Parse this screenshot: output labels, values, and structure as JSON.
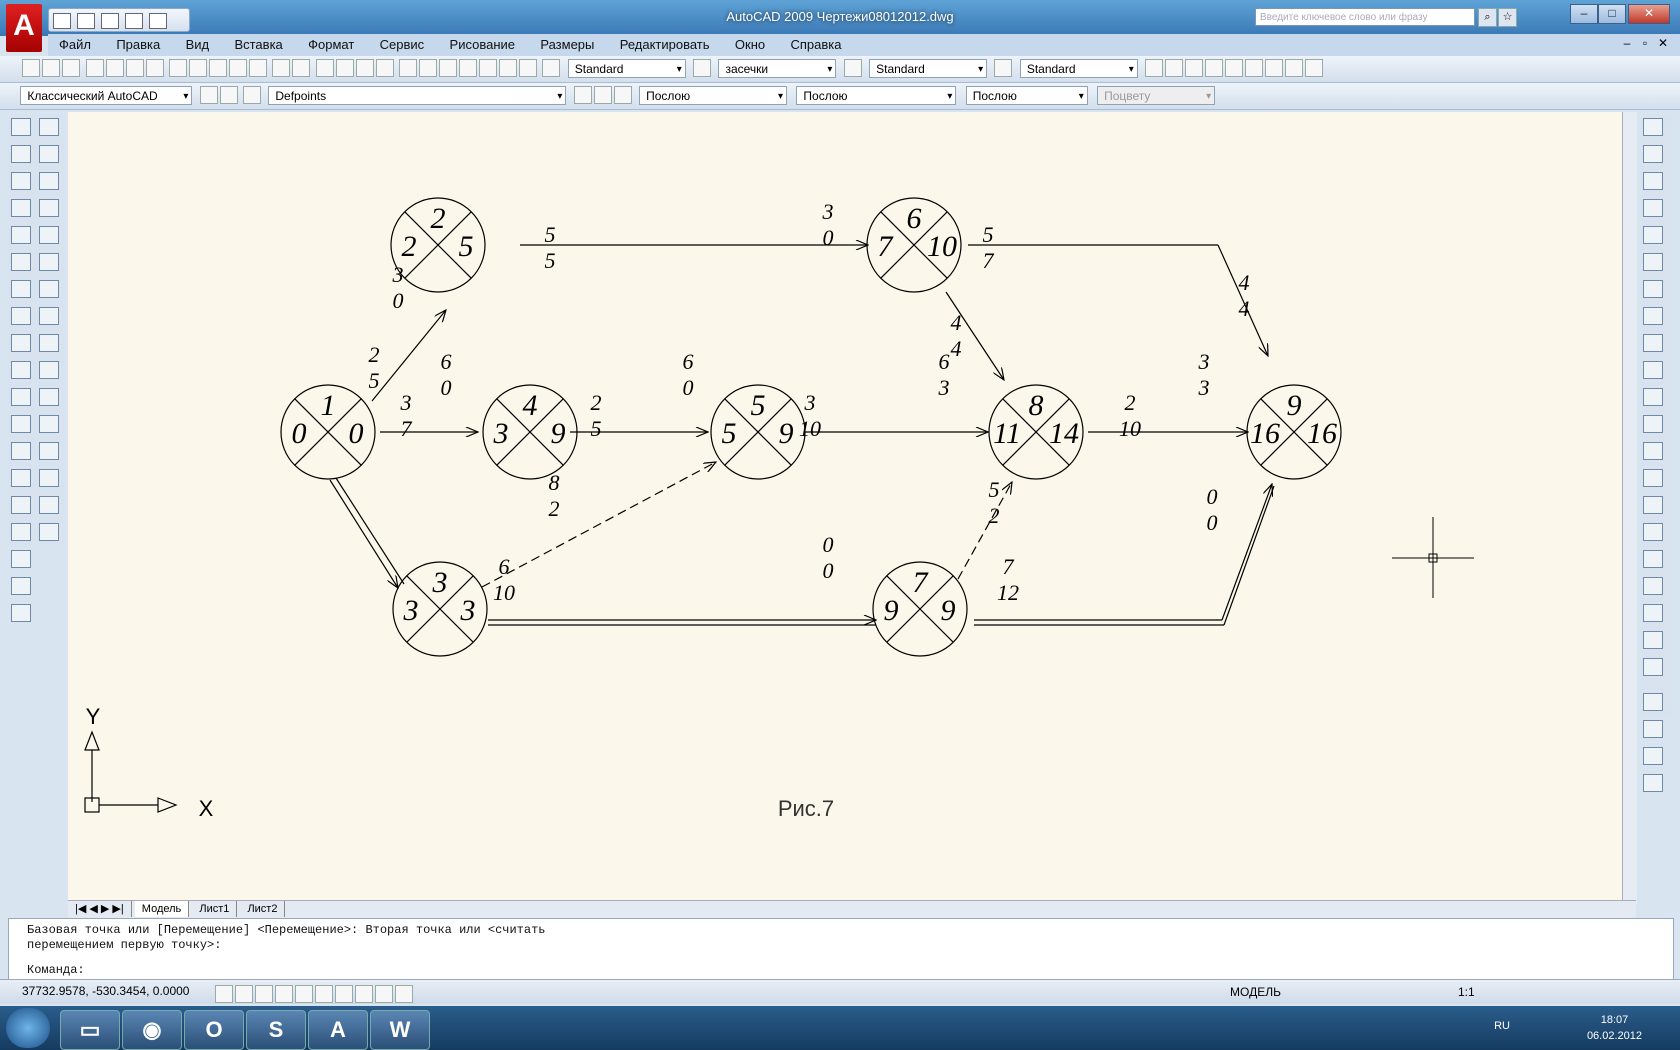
{
  "window": {
    "title": "AutoCAD 2009 Чертежи08012012.dwg",
    "search_placeholder": "Введите ключевое слово или фразу",
    "logo_letter": "A"
  },
  "menu": [
    "Файл",
    "Правка",
    "Вид",
    "Вставка",
    "Формат",
    "Сервис",
    "Рисование",
    "Размеры",
    "Редактировать",
    "Окно",
    "Справка"
  ],
  "toolbar1": {
    "text_style": "Standard",
    "hatch": "засечки",
    "table_style": "Standard",
    "mleader_style": "Standard"
  },
  "toolbar2": {
    "workspace": "Классический AutoCAD",
    "layer": "Defpoints",
    "color": "Послою",
    "linetype": "Послою",
    "lineweight": "Послою",
    "plotstyle": "Поцвету"
  },
  "diagram": {
    "nodes": [
      {
        "top": "1",
        "left": "0",
        "right": "0",
        "bottom": ""
      },
      {
        "top": "2",
        "left": "2",
        "right": "5",
        "bottom": ""
      },
      {
        "top": "3",
        "left": "3",
        "right": "3",
        "bottom": ""
      },
      {
        "top": "4",
        "left": "3",
        "right": "9",
        "bottom": ""
      },
      {
        "top": "5",
        "left": "5",
        "right": "9",
        "bottom": ""
      },
      {
        "top": "6",
        "left": "7",
        "right": "10",
        "bottom": ""
      },
      {
        "top": "7",
        "left": "9",
        "right": "9",
        "bottom": ""
      },
      {
        "top": "8",
        "left": "11",
        "right": "14",
        "bottom": ""
      },
      {
        "top": "9",
        "left": "16",
        "right": "16",
        "bottom": ""
      }
    ],
    "edge_labels": [
      {
        "num": "3",
        "den": "0"
      },
      {
        "num": "2",
        "den": "5"
      },
      {
        "num": "3",
        "den": "7"
      },
      {
        "num": "6",
        "den": "0"
      },
      {
        "num": "5",
        "den": "5"
      },
      {
        "num": "3",
        "den": "0"
      },
      {
        "num": "5",
        "den": "7"
      },
      {
        "num": "4",
        "den": "4"
      },
      {
        "num": "4",
        "den": "4"
      },
      {
        "num": "2",
        "den": "5"
      },
      {
        "num": "6",
        "den": "0"
      },
      {
        "num": "3",
        "den": "10"
      },
      {
        "num": "6",
        "den": "3"
      },
      {
        "num": "2",
        "den": "10"
      },
      {
        "num": "3",
        "den": "3"
      },
      {
        "num": "8",
        "den": "2"
      },
      {
        "num": "5",
        "den": "2"
      },
      {
        "num": "0",
        "den": "0"
      },
      {
        "num": "6",
        "den": "10"
      },
      {
        "num": "0",
        "den": "0"
      },
      {
        "num": "7",
        "den": "12"
      }
    ],
    "caption": "Рис.7",
    "ucs_y": "Y",
    "ucs_x": "X"
  },
  "layout_tabs": [
    "Модель",
    "Лист1",
    "Лист2"
  ],
  "command": {
    "line1": "Базовая точка или [Перемещение] <Перемещение>: Вторая точка или <считать",
    "line2": "перемещением первую точку>:",
    "prompt": "Команда:"
  },
  "status": {
    "coords": "37732.9578, -530.3454, 0.0000",
    "model": "МОДЕЛЬ",
    "scale": "1:1"
  },
  "taskbar": {
    "lang": "RU",
    "time": "18:07",
    "date": "06.02.2012"
  }
}
